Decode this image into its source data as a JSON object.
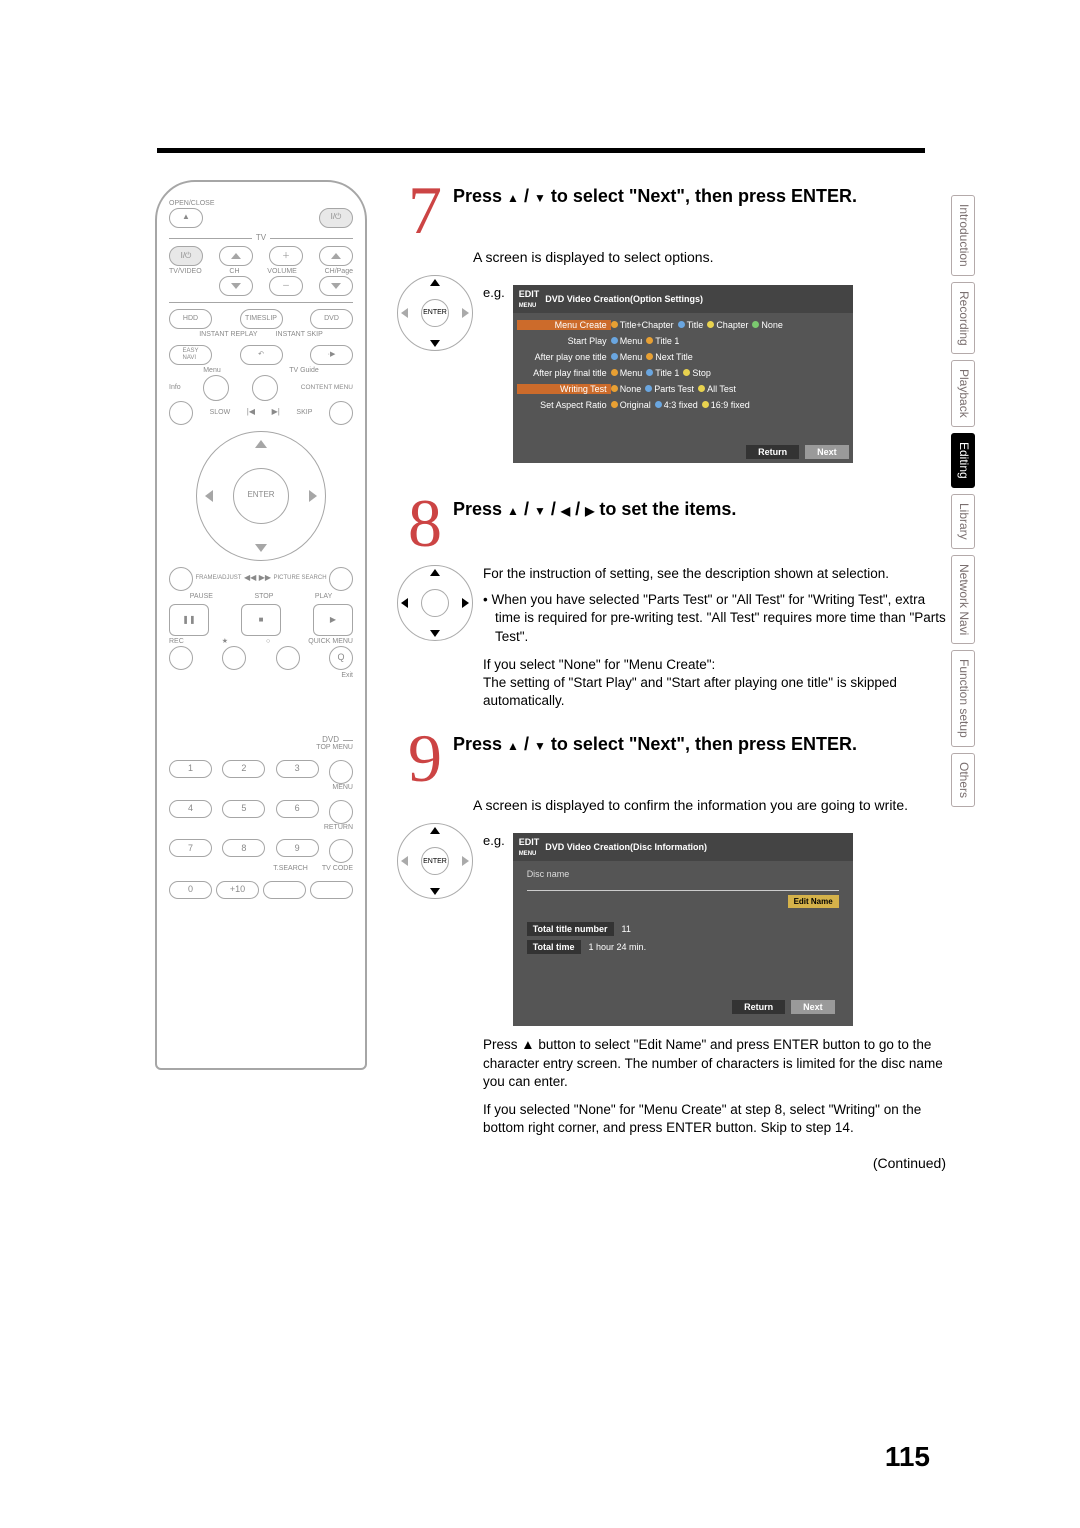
{
  "page_number": "115",
  "continued": "(Continued)",
  "tabs": [
    "Introduction",
    "Recording",
    "Playback",
    "Editing",
    "Library",
    "Network Navi",
    "Function setup",
    "Others"
  ],
  "active_tab": "Editing",
  "remote": {
    "open_close": "OPEN/CLOSE",
    "tv": "TV",
    "col_labels": [
      "TV/VIDEO",
      "CH",
      "VOLUME",
      "CH/Page"
    ],
    "hdd": "HDD",
    "timeslip": "TIMESLIP",
    "dvd": "DVD",
    "rep_labels": [
      "INSTANT REPLAY",
      "INSTANT SKIP"
    ],
    "easy": "EASY\nNAVI",
    "menu": "Menu",
    "tvg": "TV Guide",
    "info": "Info",
    "cm": "CONTENT MENU",
    "slow": "SLOW",
    "skip": "SKIP",
    "enter": "ENTER",
    "fa": "FRAME/ADJUST",
    "ps": "PICTURE SEARCH",
    "pause": "PAUSE",
    "stop": "STOP",
    "play": "PLAY",
    "rec": "REC",
    "qm": "QUICK MENU",
    "exit": "Exit",
    "dvd2": "DVD",
    "topm": "TOP MENU",
    "menu2": "MENU",
    "return": "RETURN",
    "tsearch": "T.SEARCH",
    "tvcode": "TV CODE",
    "plus10": "+10",
    "nums": [
      "1",
      "2",
      "3",
      "4",
      "5",
      "6",
      "7",
      "8",
      "9",
      "0"
    ]
  },
  "steps": {
    "s7": {
      "n": "7",
      "title_a": "Press ",
      "title_b": " to select \"Next\", then press ENTER.",
      "desc": "A screen is displayed to select options.",
      "eg": "e.g."
    },
    "s8": {
      "n": "8",
      "title_a": "Press ",
      "title_b": " to set the items.",
      "p1": "For the instruction of setting, see the description shown at selection.",
      "p2": "When you have selected \"Parts Test\" or \"All Test\" for \"Writing Test\", extra time is required for pre-writing test. \"All Test\" requires more time than \"Parts Test\".",
      "p3": "If you select \"None\" for \"Menu Create\":\nThe setting of \"Start Play\" and \"Start after playing one title\" is skipped automatically."
    },
    "s9": {
      "n": "9",
      "title_a": "Press ",
      "title_b": " to select \"Next\", then press ENTER.",
      "desc": "A screen is displayed to confirm the information you are going to write.",
      "eg": "e.g.",
      "p1": "Press ▲ button to select \"Edit Name\" and press ENTER button to go to the character entry screen. The number of characters is limited for the disc name you can enter.",
      "p2": "If you selected \"None\" for \"Menu Create\" at step 8, select \"Writing\" on the bottom right corner, and press ENTER button. Skip to step 14."
    }
  },
  "osd1": {
    "brand": "EDIT",
    "sub": "MENU",
    "title": "DVD Video Creation(Option Settings)",
    "rows": [
      {
        "lbl": "Menu Create",
        "hl": true,
        "opts": [
          [
            "o",
            "Title+Chapter"
          ],
          [
            "b",
            "Title"
          ],
          [
            "y",
            "Chapter"
          ],
          [
            "g",
            "None"
          ]
        ]
      },
      {
        "lbl": "Start Play",
        "opts": [
          [
            "b",
            "Menu"
          ],
          [
            "o",
            "Title 1"
          ]
        ]
      },
      {
        "lbl": "After play one title",
        "opts": [
          [
            "b",
            "Menu"
          ],
          [
            "o",
            "Next Title"
          ]
        ]
      },
      {
        "lbl": "After play final title",
        "opts": [
          [
            "o",
            "Menu"
          ],
          [
            "b",
            "Title 1"
          ],
          [
            "y",
            "Stop"
          ]
        ]
      },
      {
        "lbl": "Writing Test",
        "hl": true,
        "opts": [
          [
            "o",
            "None"
          ],
          [
            "b",
            "Parts Test"
          ],
          [
            "y",
            "All Test"
          ]
        ]
      },
      {
        "lbl": "Set Aspect Ratio",
        "opts": [
          [
            "o",
            "Original"
          ],
          [
            "b",
            "4:3 fixed"
          ],
          [
            "y",
            "16:9 fixed"
          ]
        ]
      }
    ],
    "return": "Return",
    "next": "Next"
  },
  "osd2": {
    "brand": "EDIT",
    "sub": "MENU",
    "title": "DVD Video Creation(Disc Information)",
    "discname": "Disc name",
    "edit": "Edit Name",
    "ttn": "Total title number",
    "ttnv": "11",
    "tt": "Total time",
    "ttv": "1 hour 24 min.",
    "return": "Return",
    "next": "Next"
  }
}
